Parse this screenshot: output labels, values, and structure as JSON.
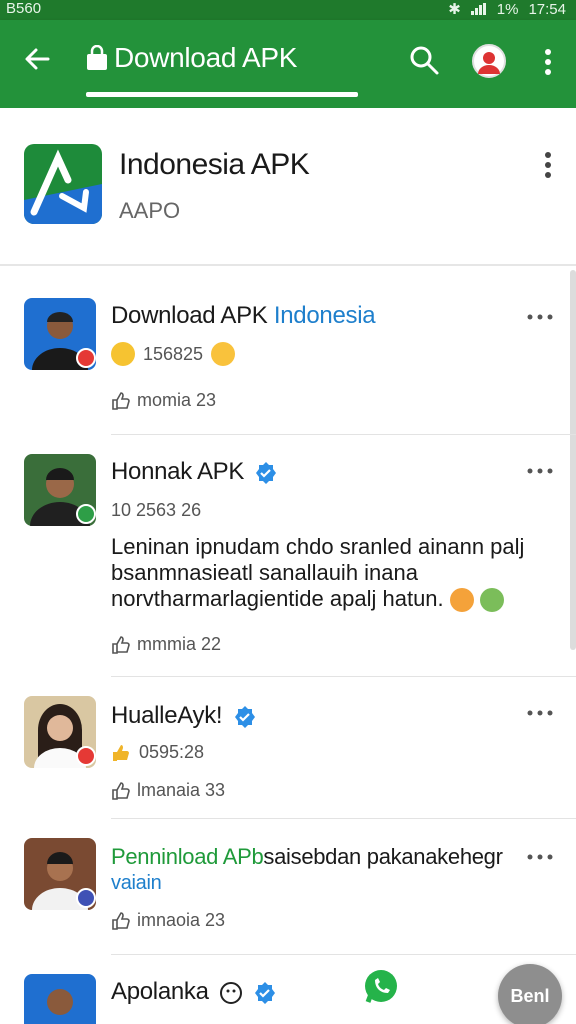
{
  "status_bar": {
    "left": "B560",
    "battery": "1%",
    "time": "17:54"
  },
  "appbar": {
    "title": "Download APK"
  },
  "app": {
    "name": "Indonesia APK",
    "developer": "AAPO"
  },
  "posts": [
    {
      "name": "Download APK",
      "name_accent": "Indonesia",
      "meta": "156825",
      "likes": "momia 23",
      "body": ""
    },
    {
      "name": "Honnak APK",
      "meta": "10 2563 26",
      "body": "Leninan ipnudam chdo sranled ainann palj bsanmnasieatl sanallauih inana norvtharmarlagientide apalj hatun.",
      "likes": "mmmia 22"
    },
    {
      "name": "HualleAyk!",
      "meta": "0595:28",
      "likes": "lmanaia 33",
      "body": ""
    },
    {
      "name_green": "Penninload APb",
      "name": "saisebdan pakanakehegr",
      "name_line2": "vaiain",
      "likes": "imnaoia 23",
      "body": ""
    },
    {
      "name": "Apolanka",
      "likes": "",
      "body": ""
    }
  ],
  "fab": {
    "label": "Benl"
  },
  "colors": {
    "appbar": "#23923a",
    "status": "#1f7a2c",
    "accent_blue": "#1e7fcc",
    "accent_green": "#1f9a3a"
  }
}
